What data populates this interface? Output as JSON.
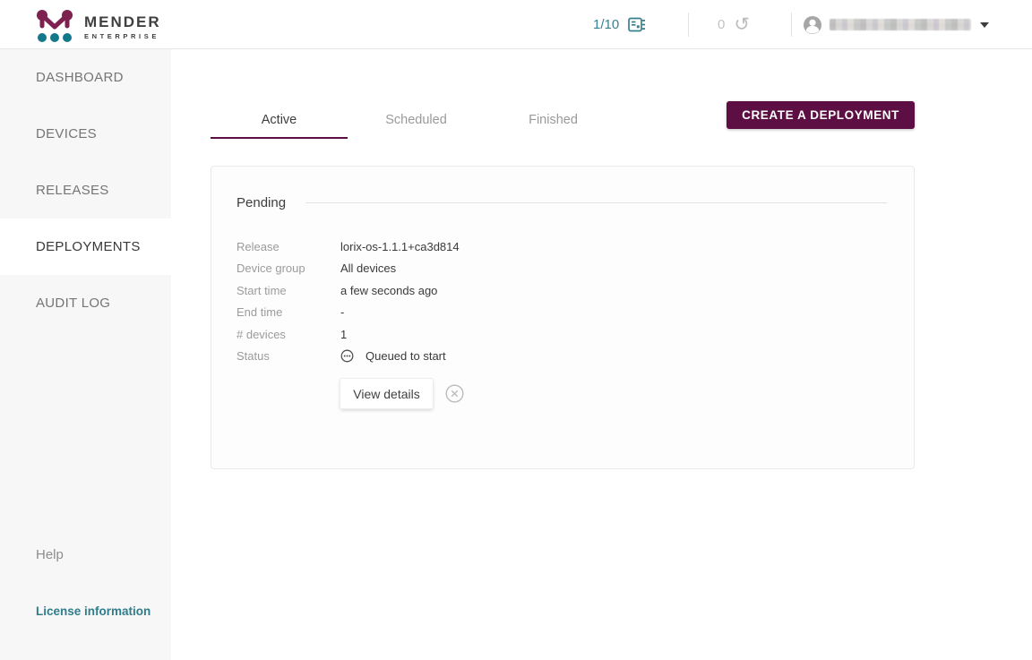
{
  "colors": {
    "brand_purple": "#5d0f43",
    "brand_teal": "#38808f",
    "logo_magenta": "#7d2150",
    "logo_teal": "#13788a",
    "link_teal": "#2f7d8c"
  },
  "header": {
    "logo_title": "MENDER",
    "logo_subtitle": "ENTERPRISE",
    "device_limit": "1/10",
    "history_count": "0"
  },
  "sidebar": {
    "items": [
      {
        "label": "DASHBOARD",
        "active": false
      },
      {
        "label": "DEVICES",
        "active": false
      },
      {
        "label": "RELEASES",
        "active": false
      },
      {
        "label": "DEPLOYMENTS",
        "active": true
      },
      {
        "label": "AUDIT LOG",
        "active": false
      }
    ],
    "help_label": "Help",
    "license_label": "License information"
  },
  "main": {
    "tabs": [
      {
        "label": "Active",
        "selected": true
      },
      {
        "label": "Scheduled",
        "selected": false
      },
      {
        "label": "Finished",
        "selected": false
      }
    ],
    "create_button_label": "CREATE A DEPLOYMENT",
    "card": {
      "title": "Pending",
      "rows": [
        {
          "label": "Release",
          "value": "lorix-os-1.1.1+ca3d814"
        },
        {
          "label": "Device group",
          "value": "All devices"
        },
        {
          "label": "Start time",
          "value": "a few seconds ago"
        },
        {
          "label": "End time",
          "value": "-"
        },
        {
          "label": "# devices",
          "value": "1"
        }
      ],
      "status": {
        "label": "Status",
        "value": "Queued to start"
      },
      "view_details_label": "View details"
    }
  }
}
